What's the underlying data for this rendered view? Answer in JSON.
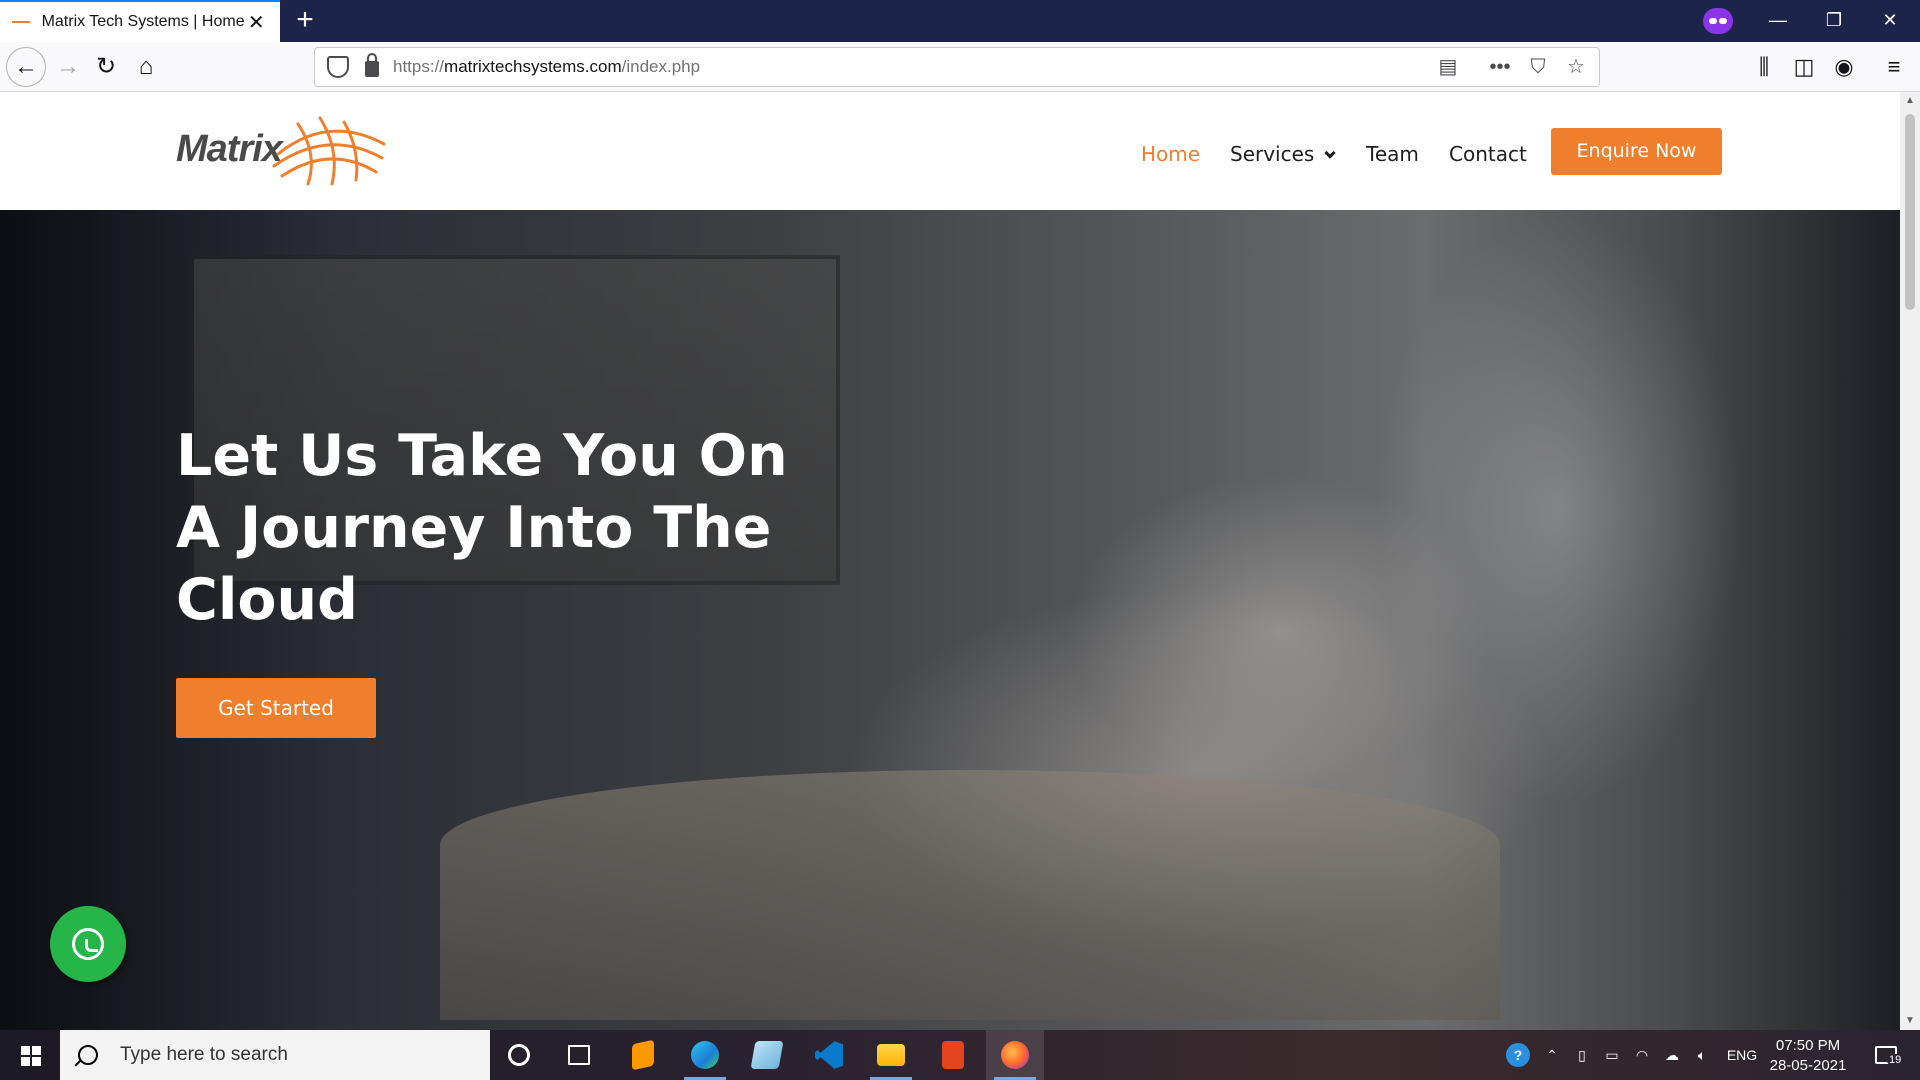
{
  "browser": {
    "tab_title": "Matrix Tech Systems | Home",
    "new_tab": "+",
    "close_tab": "✕",
    "url_prefix": "https://",
    "url_host": "matrixtechsystems.com",
    "url_path": "/index.php",
    "more": "•••",
    "window_minimize": "—",
    "window_restore": "❐",
    "window_close": "✕"
  },
  "site": {
    "logo_text": "Matrix",
    "nav": {
      "home": "Home",
      "services": "Services",
      "team": "Team",
      "contact": "Contact"
    },
    "enquire_label": "Enquire Now",
    "hero_title": "Let Us Take You On A Journey Into The Cloud",
    "get_started_label": "Get Started"
  },
  "taskbar": {
    "search_placeholder": "Type here to search",
    "language": "ENG",
    "time": "07:50 PM",
    "date": "28-05-2021",
    "notification_count": "19"
  },
  "colors": {
    "accent": "#ef7f2c",
    "whatsapp": "#25b548",
    "tabbar": "#1c2449"
  }
}
